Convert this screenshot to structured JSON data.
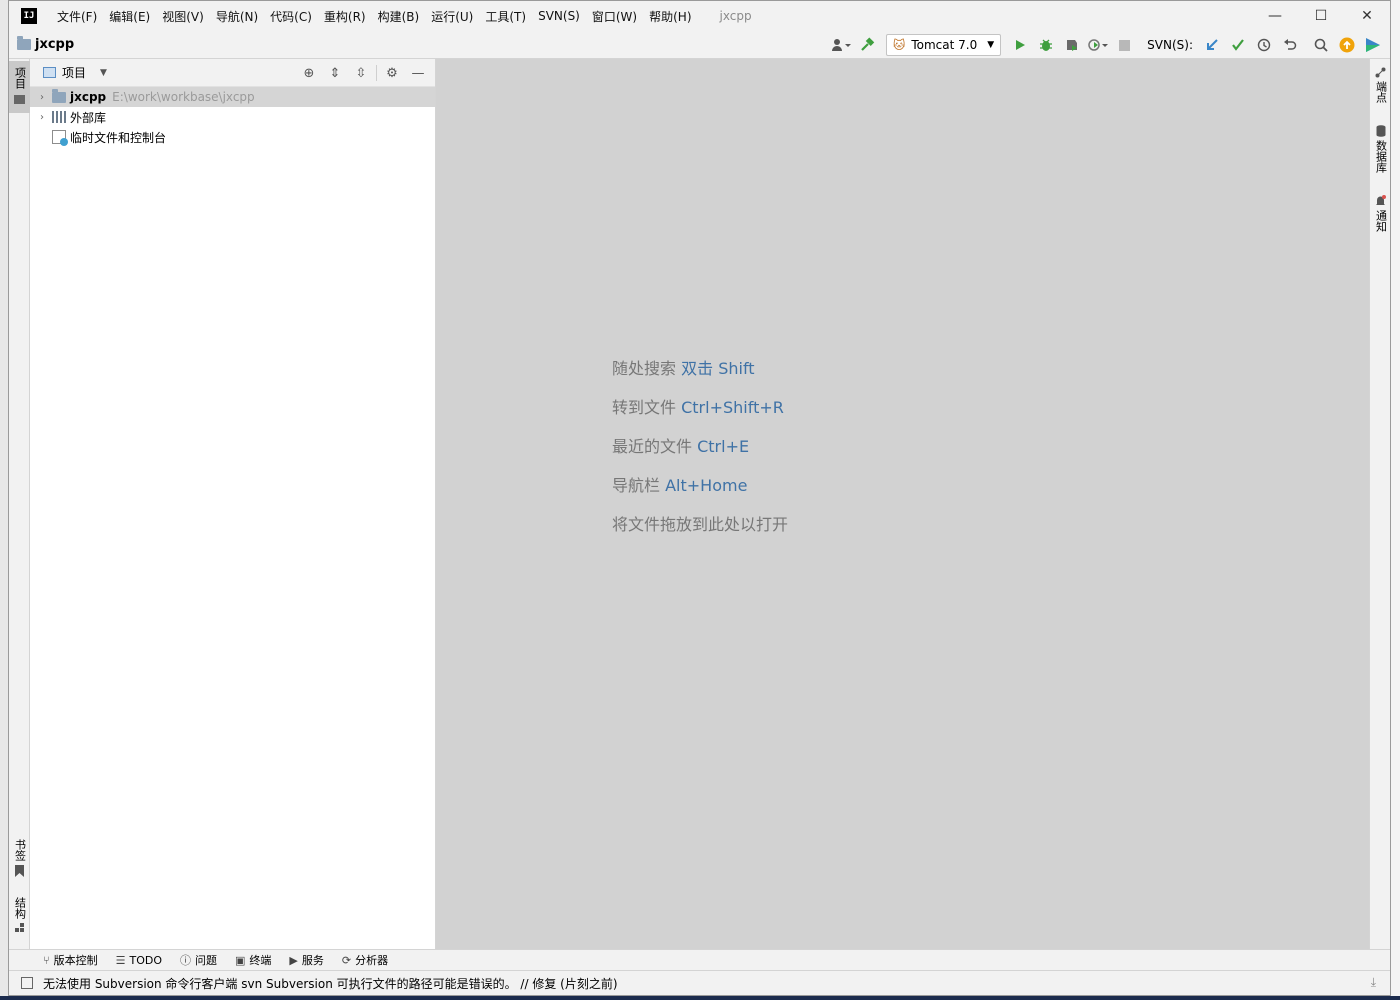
{
  "window": {
    "logo": "IJ",
    "menu": [
      "文件(F)",
      "编辑(E)",
      "视图(V)",
      "导航(N)",
      "代码(C)",
      "重构(R)",
      "构建(B)",
      "运行(U)",
      "工具(T)",
      "SVN(S)",
      "窗口(W)",
      "帮助(H)"
    ],
    "title": "jxcpp",
    "controls": {
      "minimize": "—",
      "maximize": "☐",
      "close": "✕"
    }
  },
  "navbar": {
    "project": "jxcpp",
    "run_config": "Tomcat 7.0",
    "svn_label": "SVN(S):"
  },
  "left_stripe": {
    "project_tab": "项目",
    "bookmarks_tab": "书签",
    "structure_tab": "结构"
  },
  "project_panel": {
    "title": "项目",
    "tree": [
      {
        "name": "jxcpp",
        "path": "E:\\work\\workbase\\jxcpp"
      },
      {
        "name": "外部库"
      },
      {
        "name": "临时文件和控制台"
      }
    ]
  },
  "editor": {
    "hints": [
      {
        "text": "随处搜索",
        "key": "双击 Shift"
      },
      {
        "text": "转到文件",
        "key": "Ctrl+Shift+R"
      },
      {
        "text": "最近的文件",
        "key": "Ctrl+E"
      },
      {
        "text": "导航栏",
        "key": "Alt+Home"
      },
      {
        "text": "将文件拖放到此处以打开",
        "key": ""
      }
    ]
  },
  "right_stripe": {
    "endpoints": "端点",
    "database": "数据库",
    "notifications": "通知"
  },
  "bottom_tools": [
    "版本控制",
    "TODO",
    "问题",
    "终端",
    "服务",
    "分析器"
  ],
  "status": {
    "message": "无法使用 Subversion 命令行客户端 svn Subversion 可执行文件的路径可能是错误的。 // 修复 (片刻之前)"
  },
  "colors": {
    "editor_bg": "#d2d2d2",
    "hint_key": "#3f72a6",
    "run_green": "#3f9f3f",
    "svn_blue": "#3a86c8"
  }
}
